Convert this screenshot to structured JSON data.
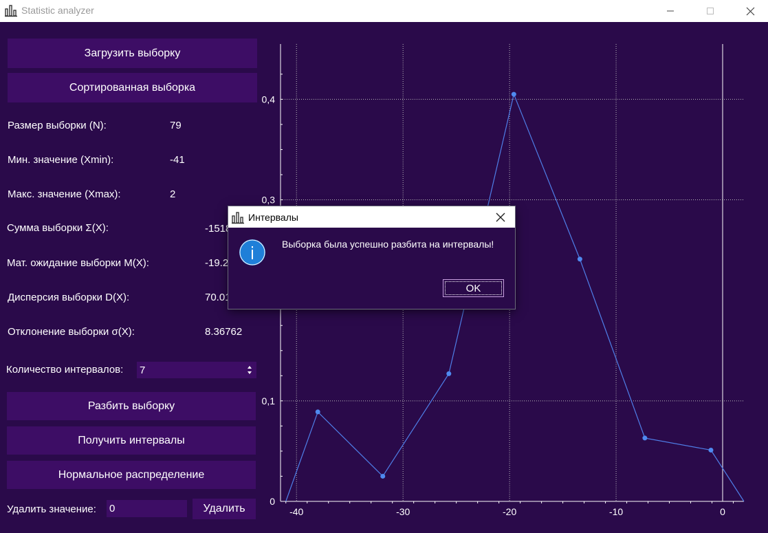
{
  "window": {
    "title": "Statistic analyzer"
  },
  "buttons": {
    "load": "Загрузить выборку",
    "sorted": "Сортированная выборка",
    "split": "Разбить выборку",
    "intervals": "Получить интервалы",
    "normal": "Нормальное распределение",
    "delete": "Удалить"
  },
  "stats": [
    {
      "label": "Размер выборки (N):",
      "value": "79"
    },
    {
      "label": "Мин. значение (Xmin):",
      "value": "-41"
    },
    {
      "label": "Макс. значение (Xmax):",
      "value": "2"
    },
    {
      "label": "Сумма выборки Σ(X):",
      "value": "-1518"
    },
    {
      "label": "Мат. ожидание выборки M(X):",
      "value": "-19.2"
    },
    {
      "label": "Дисперсия выборки D(X):",
      "value": "70.01"
    },
    {
      "label": "Отклонение выборки σ(X):",
      "value": "8.36762"
    }
  ],
  "intervals_count": {
    "label": "Количество интервалов:",
    "value": "7"
  },
  "delete_value": {
    "label": "Удалить значение:",
    "value": "0"
  },
  "dialog": {
    "title": "Интервалы",
    "message": "Выборка была успешно разбита на интервалы!",
    "ok": "OK"
  },
  "colors": {
    "background": "#2a0a4a",
    "button": "#3d0d65",
    "line": "#4f7fe8",
    "info": "#1f7fd8"
  },
  "chart_data": {
    "type": "line",
    "x": [
      -41,
      -38,
      -31.9,
      -25.7,
      -19.6,
      -13.4,
      -7.3,
      -1.1,
      2
    ],
    "y": [
      0,
      0.089,
      0.025,
      0.127,
      0.405,
      0.241,
      0.063,
      0.051,
      0
    ],
    "xlim": [
      -41.5,
      2
    ],
    "ylim": [
      0,
      0.455
    ],
    "x_ticks": [
      -40,
      -30,
      -20,
      -10,
      0
    ],
    "y_ticks": [
      0,
      0.1,
      0.3,
      0.4
    ],
    "y_tick_labels": [
      "0",
      "0,1",
      "0,3",
      "0,4"
    ],
    "grid": true
  }
}
